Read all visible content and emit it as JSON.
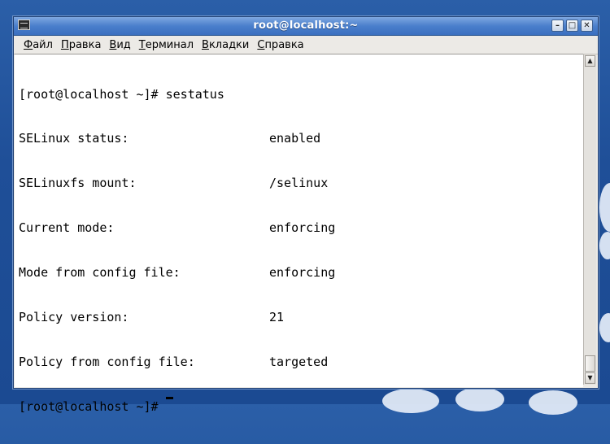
{
  "window": {
    "title": "root@localhost:~",
    "buttons": {
      "minimize": "–",
      "maximize": "□",
      "close": "✕"
    }
  },
  "menu": [
    "Файл",
    "Правка",
    "Вид",
    "Терминал",
    "Вкладки",
    "Справка"
  ],
  "terminal": {
    "prompt_line": "[root@localhost ~]# sestatus",
    "rows": [
      {
        "key": "SELinux status:",
        "value": "enabled"
      },
      {
        "key": "SELinuxfs mount:",
        "value": "/selinux"
      },
      {
        "key": "Current mode:",
        "value": "enforcing"
      },
      {
        "key": "Mode from config file:",
        "value": "enforcing"
      },
      {
        "key": "Policy version:",
        "value": "21"
      },
      {
        "key": "Policy from config file:",
        "value": "targeted"
      }
    ],
    "final_prompt": "[root@localhost ~]#"
  },
  "scrollbar": {
    "up_arrow": "▲",
    "down_arrow": "▼"
  },
  "colors": {
    "titlebar": "#4a7fcc",
    "desktop": "#1f4f98",
    "terminal_bg": "#ffffff"
  }
}
